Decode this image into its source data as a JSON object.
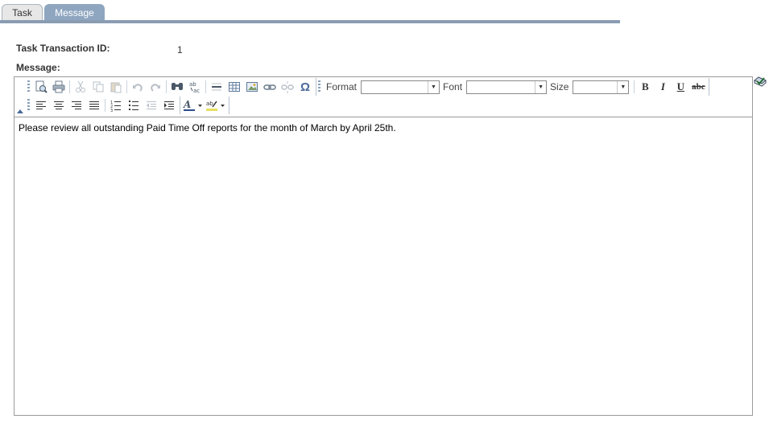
{
  "tabs": [
    {
      "label": "Task"
    },
    {
      "label": "Message"
    }
  ],
  "fields": {
    "task_transaction_id_label": "Task Transaction ID:",
    "task_transaction_id_value": "1",
    "message_label": "Message:"
  },
  "editor": {
    "toolbar": {
      "format_label": "Format",
      "font_label": "Font",
      "size_label": "Size",
      "format_value": "",
      "font_value": "",
      "size_value": ""
    },
    "content": "Please review all outstanding Paid Time Off reports for the month of March by April 25th."
  },
  "icons": [
    "preview-icon",
    "print-icon",
    "cut-icon",
    "copy-icon",
    "paste-icon",
    "undo-icon",
    "redo-icon",
    "find-icon",
    "replace-icon",
    "horizontal-rule-icon",
    "table-icon",
    "image-icon",
    "link-icon",
    "unlink-icon",
    "special-char-icon",
    "bold-icon",
    "italic-icon",
    "underline-icon",
    "strikethrough-icon",
    "align-left-icon",
    "align-center-icon",
    "align-right-icon",
    "justify-icon",
    "numbered-list-icon",
    "bulleted-list-icon",
    "outdent-icon",
    "indent-icon",
    "text-color-icon",
    "highlight-color-icon",
    "spell-check-icon"
  ],
  "colors": {
    "tab_active": "#8fa6c0",
    "tab_rule": "#8a9cb2"
  }
}
